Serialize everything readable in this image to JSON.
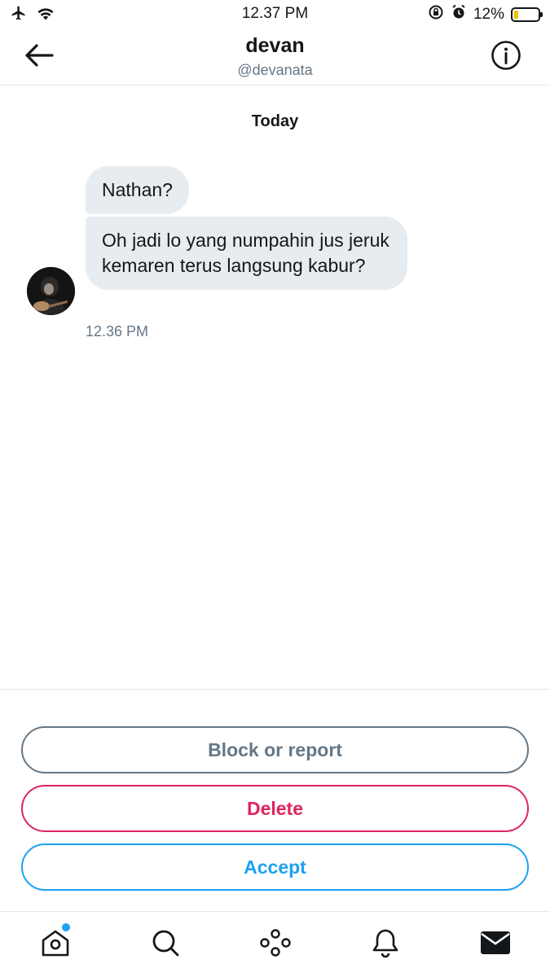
{
  "status_bar": {
    "time": "12.37 PM",
    "battery_percent": "12%",
    "icons": [
      "airplane-icon",
      "wifi-icon",
      "orientation-lock-icon",
      "alarm-icon",
      "battery-icon"
    ]
  },
  "header": {
    "name": "devan",
    "handle": "@devanata",
    "back_icon": "back-arrow-icon",
    "info_icon": "info-icon"
  },
  "conversation": {
    "day_label": "Today",
    "messages": [
      {
        "text": "Nathan?"
      },
      {
        "text": "Oh jadi lo yang numpahin jus jeruk kemaren terus langsung kabur?"
      }
    ],
    "timestamp": "12.36 PM"
  },
  "actions": {
    "block_label": "Block or report",
    "delete_label": "Delete",
    "accept_label": "Accept"
  },
  "tab_bar": {
    "tabs": [
      "home-icon",
      "search-icon",
      "spaces-icon",
      "notifications-icon",
      "messages-icon"
    ],
    "home_has_notification": true
  },
  "colors": {
    "accent": "#1da1f2",
    "danger": "#e0245e",
    "muted": "#657786",
    "bubble": "#e6ecf0"
  }
}
